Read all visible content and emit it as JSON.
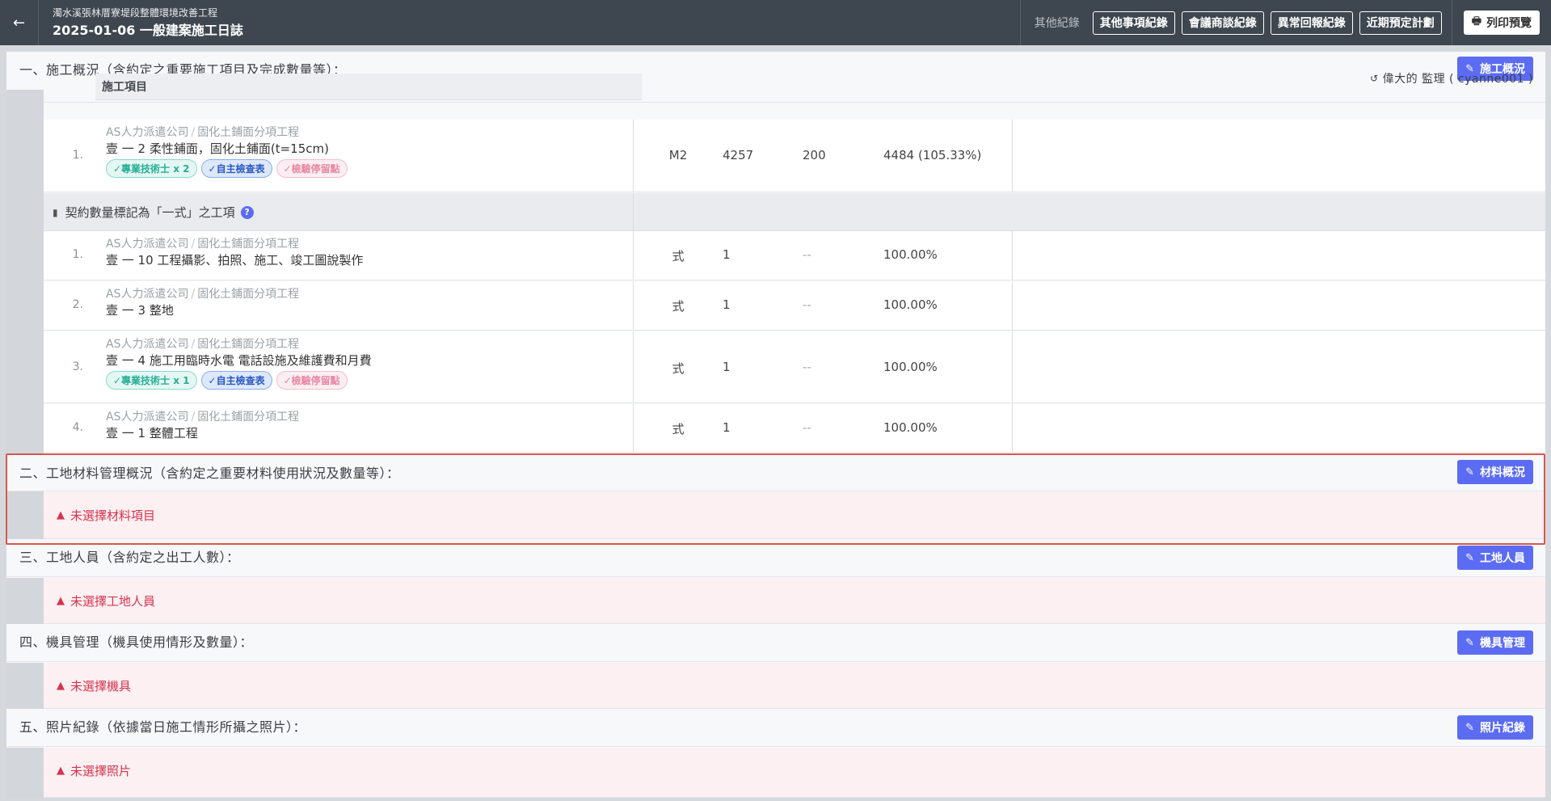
{
  "header": {
    "back_icon": "arrow-left-icon",
    "project_name": "濁水溪張林厝寮堤段整體環境改善工程",
    "doc_title": "2025-01-06 一般建案施工日誌",
    "others_label": "其他紀錄",
    "buttons": [
      "其他事項紀錄",
      "會議商談紀錄",
      "異常回報紀錄",
      "近期預定計劃"
    ],
    "print_label": "列印預覽"
  },
  "section1": {
    "title": "一、施工概況（含約定之重要施工項目及完成數量等）：",
    "edit_label": "施工概況",
    "supervisor": "偉大的 監理 ( cyanne001 )",
    "column_header": "施工項目",
    "rows": [
      {
        "num": "1.",
        "org": "AS人力派遣公司",
        "cat": "固化土鋪面分項工程",
        "name": "壹 一 2  柔性鋪面，固化土鋪面(t=15cm)",
        "unit": "M2",
        "q1": "4257",
        "q2": "200",
        "pct": "4484 (105.33%)",
        "tags": [
          "✓專業技術士 x 2",
          "✓自主檢查表",
          "✓檢驗停留點"
        ]
      }
    ],
    "group_label": "契約數量標記為「一式」之工項",
    "lump_rows": [
      {
        "num": "1.",
        "org": "AS人力派遣公司",
        "cat": "固化土鋪面分項工程",
        "name": "壹 一 10  工程攝影、拍照、施工、竣工圖說製作",
        "unit": "式",
        "q1": "1",
        "q2": "--",
        "pct": "100.00%"
      },
      {
        "num": "2.",
        "org": "AS人力派遣公司",
        "cat": "固化土鋪面分項工程",
        "name": "壹 一 3  整地",
        "unit": "式",
        "q1": "1",
        "q2": "--",
        "pct": "100.00%"
      },
      {
        "num": "3.",
        "org": "AS人力派遣公司",
        "cat": "固化土鋪面分項工程",
        "name": "壹 一 4  施工用臨時水電 電話設施及維護費和月費",
        "unit": "式",
        "q1": "1",
        "q2": "--",
        "pct": "100.00%",
        "tags": [
          "✓專業技術士 x 1",
          "✓自主檢查表",
          "✓檢驗停留點"
        ]
      },
      {
        "num": "4.",
        "org": "AS人力派遣公司",
        "cat": "固化土鋪面分項工程",
        "name": "壹 一 1  整體工程",
        "unit": "式",
        "q1": "1",
        "q2": "--",
        "pct": "100.00%"
      }
    ]
  },
  "section2": {
    "title": "二、工地材料管理概況（含約定之重要材料使用狀況及數量等）：",
    "edit_label": "材料概況",
    "warning": "未選擇材料項目"
  },
  "section3": {
    "title": "三、工地人員（含約定之出工人數）：",
    "edit_label": "工地人員",
    "warning": "未選擇工地人員"
  },
  "section4": {
    "title": "四、機具管理（機具使用情形及數量）：",
    "edit_label": "機具管理",
    "warning": "未選擇機具"
  },
  "section5": {
    "title": "五、照片紀錄（依據當日施工情形所攝之照片）：",
    "edit_label": "照片紀錄",
    "warning": "未選擇照片"
  }
}
